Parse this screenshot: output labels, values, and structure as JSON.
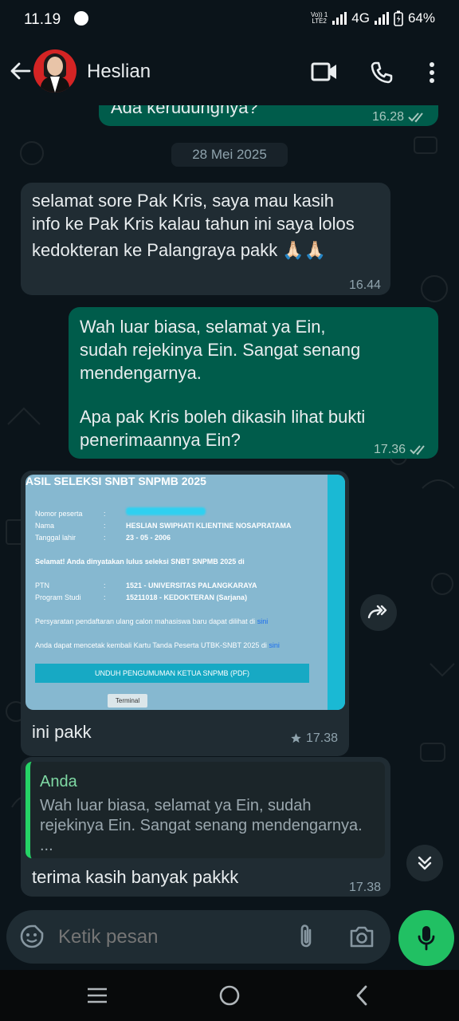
{
  "status_bar": {
    "time": "11.19",
    "volte_line1": "Vo)) 1",
    "volte_line2": "LTE2",
    "network": "4G",
    "battery": "64%"
  },
  "header": {
    "contact_name": "Heslian"
  },
  "chat": {
    "prev_message": {
      "text": "Ada kerudungnya?",
      "time": "16.28"
    },
    "date_chip": "28 Mei 2025",
    "messages": [
      {
        "direction": "incoming",
        "lines": [
          "selamat sore Pak Kris, saya mau kasih",
          "info ke Pak Kris kalau tahun ini saya lolos",
          "kedokteran ke Palangraya pakk 🙏🏻🙏🏻"
        ],
        "time": "16.44"
      },
      {
        "direction": "outgoing",
        "lines": [
          "Wah luar biasa, selamat ya Ein,",
          "sudah rejekinya Ein. Sangat senang",
          "mendengarnya.",
          "",
          "Apa pak Kris boleh dikasih lihat bukti",
          "penerimaannya Ein?"
        ],
        "time": "17.36"
      },
      {
        "direction": "incoming",
        "caption": "ini pakk",
        "time": "17.38",
        "image": {
          "title": "ASIL SELEKSI SNBT SNPMB 2025",
          "fields": [
            {
              "key": "Nomor peserta",
              "sep": ":",
              "value": ""
            },
            {
              "key": "Nama",
              "sep": ":",
              "value": "HESLIAN SWIPHATI KLIENTINE NOSAPRATAMA"
            },
            {
              "key": "Tanggal lahir",
              "sep": ":",
              "value": "23 - 05 - 2006"
            }
          ],
          "congrats": "Selamat! Anda dinyatakan lulus seleksi SNBT SNPMB 2025 di",
          "fields2": [
            {
              "key": "PTN",
              "sep": ":",
              "value": "1521 - UNIVERSITAS PALANGKARAYA"
            },
            {
              "key": "Program Studi",
              "sep": ":",
              "value": "15211018 - KEDOKTERAN (Sarjana)"
            }
          ],
          "note1": "Persyaratan pendaftaran ulang calon mahasiswa baru dapat dilihat di",
          "note1_link": "sini",
          "note2": "Anda dapat mencetak kembali Kartu Tanda Peserta UTBK-SNBT 2025 di",
          "note2_link": "sini",
          "button": "UNDUH PENGUMUMAN KETUA SNPMB (PDF)",
          "terminal": "Terminal"
        }
      },
      {
        "direction": "incoming",
        "quote_name": "Anda",
        "quote_lines": [
          "Wah luar biasa, selamat ya Ein, sudah",
          "rejekinya Ein. Sangat senang mendengarnya.",
          "..."
        ],
        "text": "terima kasih banyak pakkk",
        "time": "17.38"
      }
    ]
  },
  "composer": {
    "placeholder": "Ketik pesan"
  },
  "colors": {
    "background": "#0b141a",
    "incoming_bubble": "#202c33",
    "outgoing_bubble": "#005c4b",
    "accent_green": "#21c063"
  }
}
